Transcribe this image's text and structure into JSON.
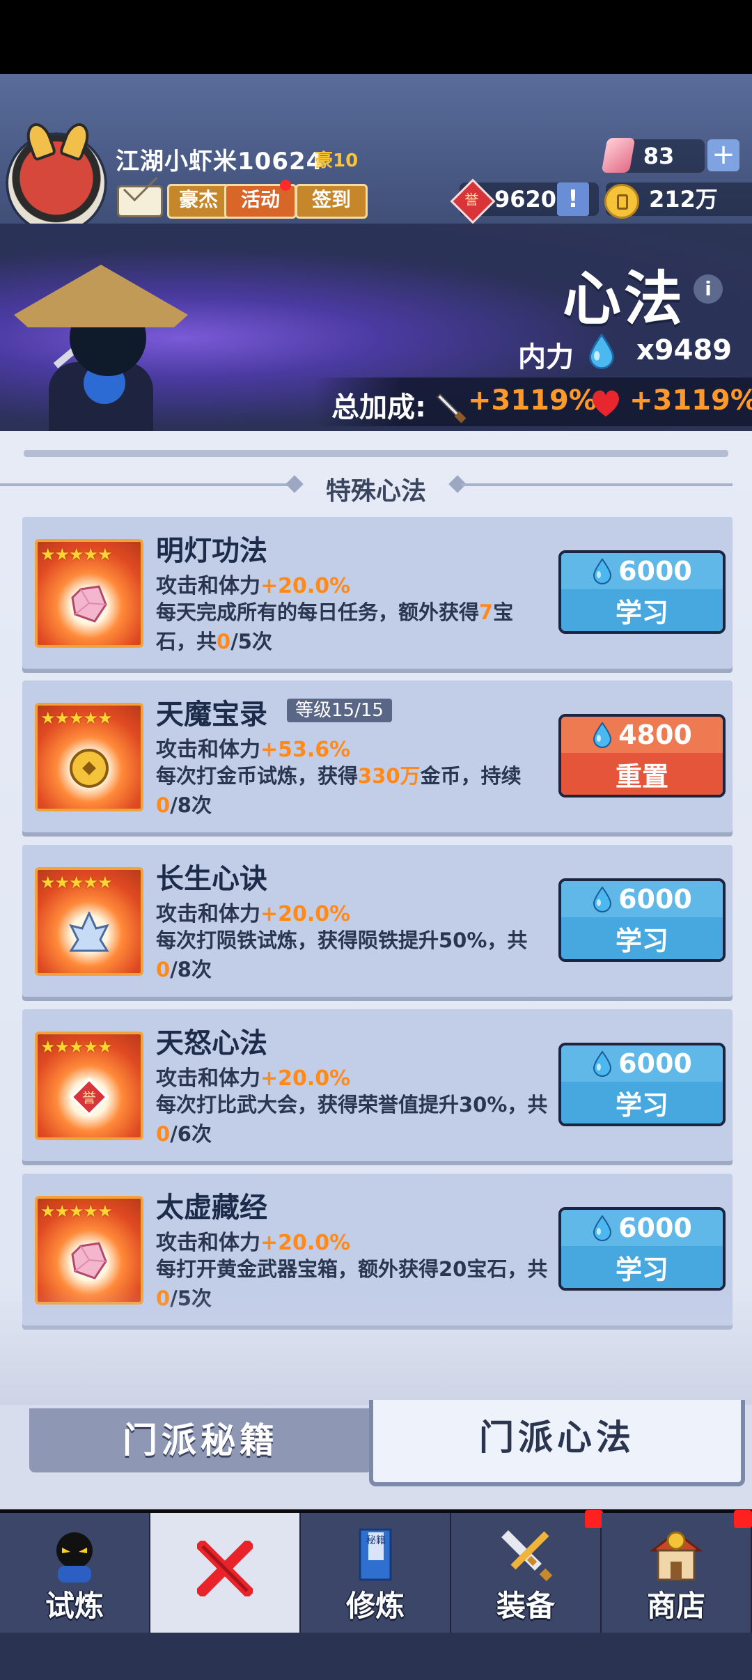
{
  "player": {
    "name": "江湖小虾米10624",
    "vip": "豪10",
    "buttons": {
      "hero": "豪杰",
      "activity": "活动",
      "signin": "签到"
    }
  },
  "currency": {
    "gems": "83",
    "gem_add": "+",
    "honor": "9620",
    "honor_glyph": "誉",
    "honor_alert": "!",
    "coins": "212万"
  },
  "hero": {
    "title": "心法",
    "info": "i",
    "neili_label": "内力",
    "neili_value": "x9489",
    "bonus_label": "总加成:",
    "atk_bonus": "+3119%",
    "hp_bonus": "+3119%"
  },
  "section_title": "特殊心法",
  "cards": [
    {
      "title": "明灯功法",
      "stars": "★★★★★",
      "emblem": "gem-icon",
      "level": "",
      "effect_prefix": "攻击和体力",
      "effect_value": "+20.0%",
      "desc_parts": [
        "每天完成所有的每日任务，额外获得",
        "7",
        "宝石，共",
        "0",
        "/5次"
      ],
      "cost": "6000",
      "action": "学习",
      "style": "blue"
    },
    {
      "title": "天魔宝录",
      "stars": "★★★★★",
      "emblem": "coin-icon",
      "level": "等级15/15",
      "effect_prefix": "攻击和体力",
      "effect_value": "+53.6%",
      "desc_parts": [
        "每次打金币试炼，获得",
        "330万",
        "金币，持续",
        "0",
        "/8次"
      ],
      "cost": "4800",
      "action": "重置",
      "style": "red"
    },
    {
      "title": "长生心诀",
      "stars": "★★★★★",
      "emblem": "meteorite-icon",
      "level": "",
      "effect_prefix": "攻击和体力",
      "effect_value": "+20.0%",
      "desc_parts": [
        "每次打陨铁试炼，获得陨铁提升50%，共",
        "0",
        "/8次",
        "",
        ""
      ],
      "cost": "6000",
      "action": "学习",
      "style": "blue"
    },
    {
      "title": "天怒心法",
      "stars": "★★★★★",
      "emblem": "honor-icon",
      "level": "",
      "effect_prefix": "攻击和体力",
      "effect_value": "+20.0%",
      "desc_parts": [
        "每次打比武大会，获得荣誉值提升30%，共",
        "0",
        "/6次",
        "",
        ""
      ],
      "cost": "6000",
      "action": "学习",
      "style": "blue"
    },
    {
      "title": "太虚藏经",
      "stars": "★★★★★",
      "emblem": "gem-icon",
      "level": "",
      "effect_prefix": "攻击和体力",
      "effect_value": "+20.0%",
      "desc_parts": [
        "每打开黄金武器宝箱，额外获得20宝石，共",
        "0",
        "/5次",
        "",
        ""
      ],
      "cost": "6000",
      "action": "学习",
      "style": "blue"
    }
  ],
  "tabs": {
    "secret": "门派秘籍",
    "xinfa": "门派心法"
  },
  "nav": [
    {
      "label": "试炼",
      "icon": "ninja-icon"
    },
    {
      "label": "",
      "icon": "crossed-swords-icon"
    },
    {
      "label": "修炼",
      "icon": "book-icon",
      "book_text": "秘籍"
    },
    {
      "label": "装备",
      "icon": "sword-icon"
    },
    {
      "label": "商店",
      "icon": "shop-icon"
    }
  ]
}
